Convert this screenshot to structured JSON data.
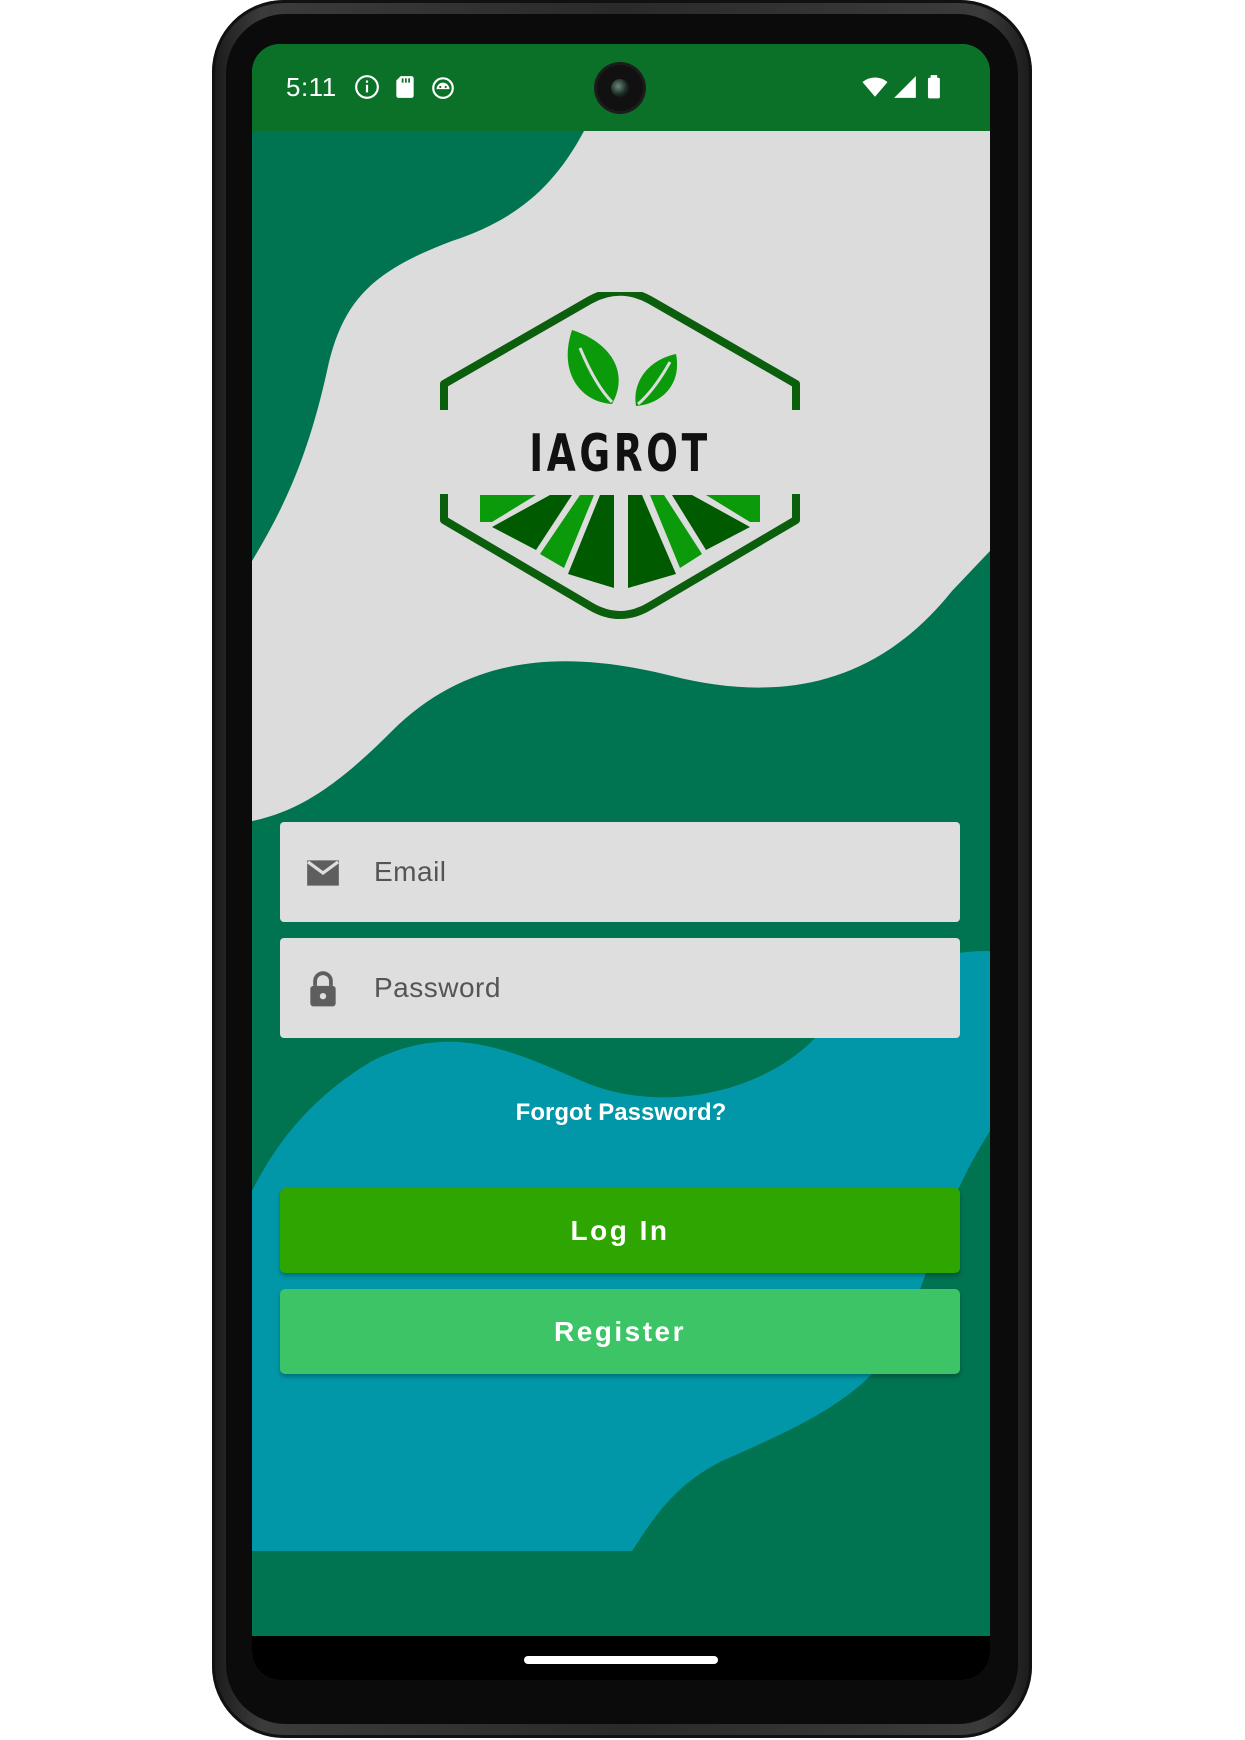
{
  "status_bar": {
    "time": "5:11",
    "left_icons": [
      "info-icon",
      "sd-card-icon",
      "android-icon"
    ],
    "right_icons": [
      "wifi-icon",
      "signal-icon",
      "battery-icon"
    ]
  },
  "logo": {
    "text": "IAGROT",
    "colors": {
      "dark_green": "#005a00",
      "mid_green": "#0a9a0a",
      "frame": "#0b5e0b"
    }
  },
  "form": {
    "email": {
      "placeholder": "Email",
      "value": "",
      "icon": "email-icon"
    },
    "password": {
      "placeholder": "Password",
      "value": "",
      "icon": "lock-icon"
    },
    "forgot_label": "Forgot Password?",
    "login_label": "Log In",
    "register_label": "Register"
  },
  "colors": {
    "status_bar": "#0b7128",
    "background_green": "#007350",
    "background_light": "#dcdcdc",
    "background_teal": "#0297a8",
    "login_button": "#2ea500",
    "register_button": "#3cc466",
    "field_background": "#dedede"
  }
}
